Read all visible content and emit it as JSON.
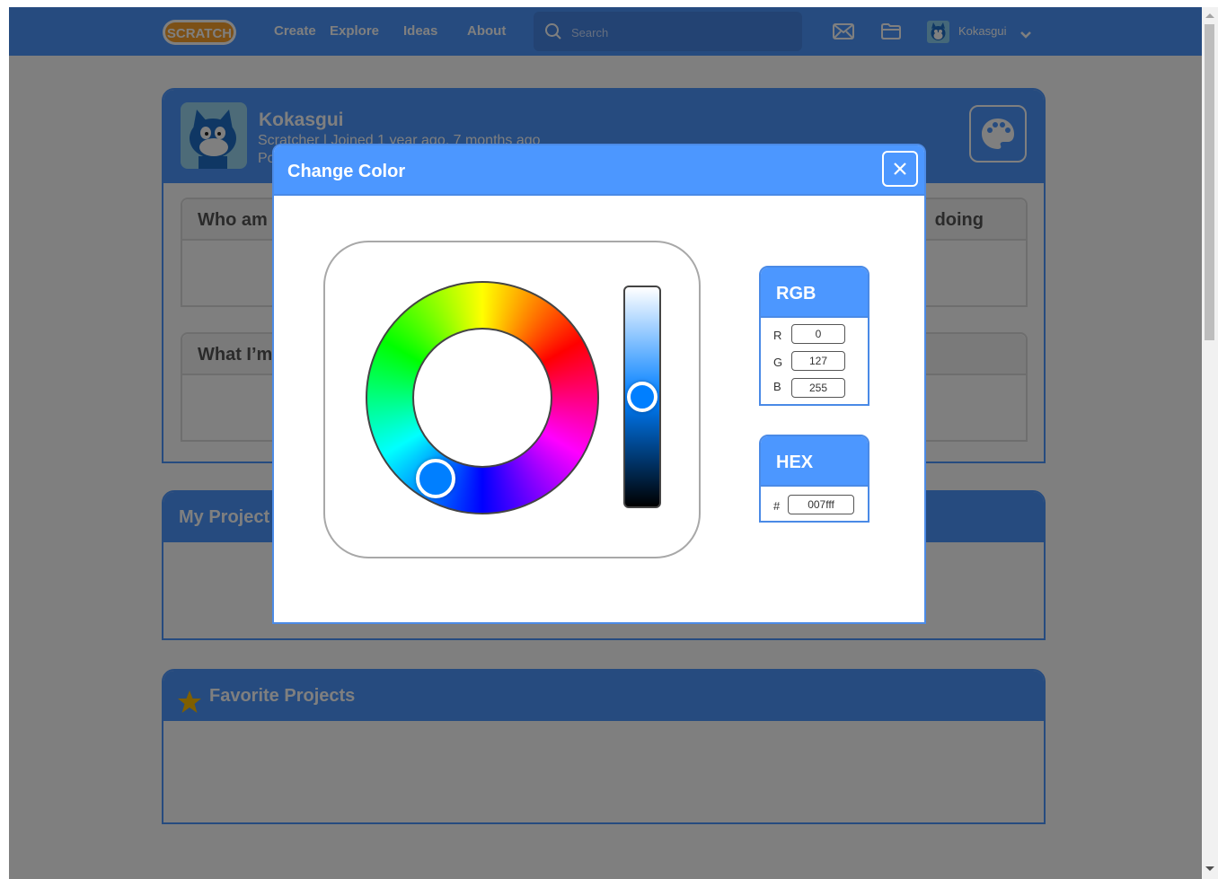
{
  "navbar": {
    "logo_text": "SCRATCH",
    "links": [
      "Create",
      "Explore",
      "Ideas",
      "About"
    ],
    "search_placeholder": "Search",
    "username": "Kokasgui",
    "icons": [
      "messages-icon",
      "my-stuff-folder-icon",
      "chevron-down-icon"
    ]
  },
  "profile": {
    "username": "Kokasgui",
    "meta": "Scratcher | Joined 1 year ago, 7 months ago",
    "meta2": "Po",
    "about_title": "Who am",
    "working_on_title": "What I’m",
    "right_card_title": "doing"
  },
  "sections": {
    "my_projects": "My Project",
    "favorite_projects": "Favorite Projects"
  },
  "modal": {
    "title": "Change Color",
    "close_label": "×",
    "selected_color": "#007fff",
    "hue_degrees": 210,
    "brightness_fraction": 0.5,
    "rgb": {
      "title": "RGB",
      "fields": [
        {
          "label": "R",
          "value": "0"
        },
        {
          "label": "G",
          "value": "127"
        },
        {
          "label": "B",
          "value": "255"
        }
      ]
    },
    "hex": {
      "title": "HEX",
      "prefix": "#",
      "value": "007fff"
    }
  },
  "colors": {
    "brand_blue": "#4c97ff",
    "logo_orange": "#f9a02c",
    "star_gold": "#ffbf00"
  }
}
